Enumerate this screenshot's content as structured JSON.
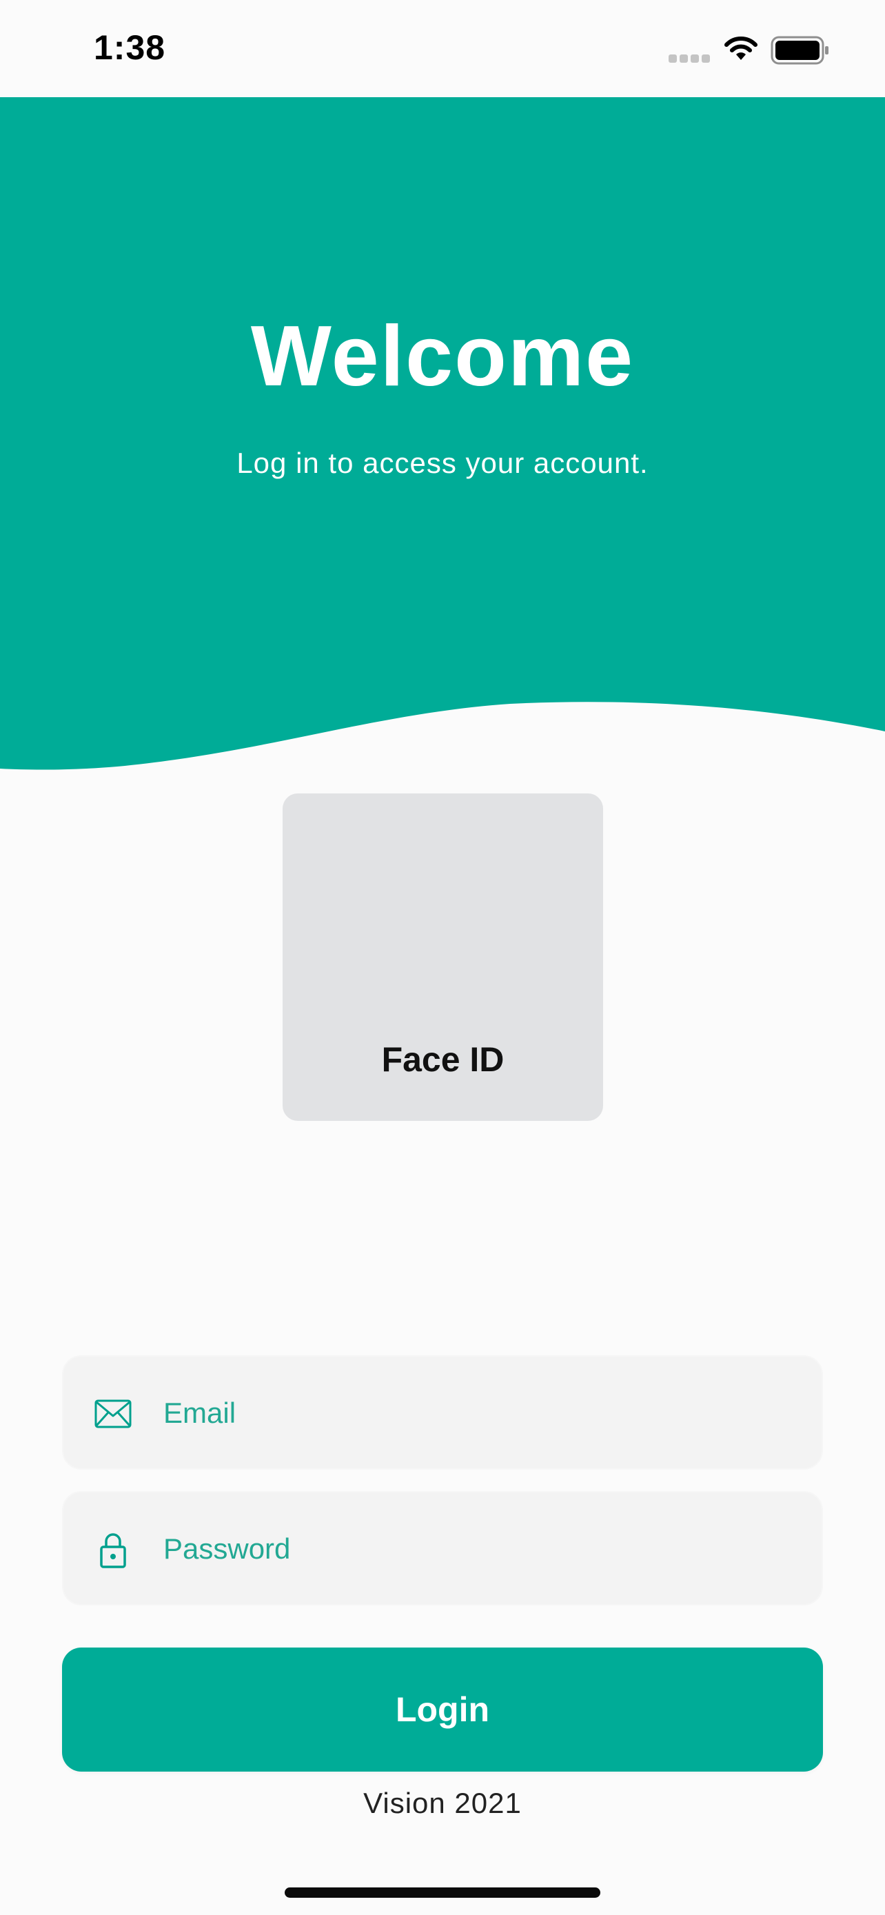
{
  "status_bar": {
    "time": "1:38"
  },
  "hero": {
    "title": "Welcome",
    "subtitle": "Log in to access your account."
  },
  "faceid": {
    "label": "Face ID"
  },
  "form": {
    "email_placeholder": "Email",
    "password_placeholder": "Password",
    "login_label": "Login"
  },
  "footer": {
    "text": "Vision 2021"
  },
  "icons": {
    "email": "mail-icon",
    "password": "lock-icon",
    "wifi": "wifi-icon",
    "battery": "battery-icon",
    "signal": "signal-icon"
  },
  "colors": {
    "accent": "#00ac97",
    "field_background": "#f3f3f3",
    "faceid_background": "#e1e2e4",
    "page_background": "#fbfbfb"
  }
}
